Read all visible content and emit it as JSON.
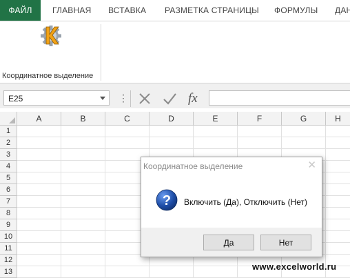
{
  "ribbon": {
    "tabs": [
      {
        "label": "ФАЙЛ"
      },
      {
        "label": "ГЛАВНАЯ"
      },
      {
        "label": "ВСТАВКА"
      },
      {
        "label": "РАЗМЕТКА СТРАНИЦЫ"
      },
      {
        "label": "ФОРМУЛЫ"
      },
      {
        "label": "ДАН"
      }
    ],
    "active_tab": "ФАЙЛ",
    "group_label": "Координатное выделение",
    "addin_icon": "addin-k-gear-icon"
  },
  "formula_bar": {
    "name_box": "E25",
    "cancel_icon": "cancel-x-icon",
    "enter_icon": "enter-check-icon",
    "function_icon": "fx-icon",
    "fx_label": "fx",
    "formula": ""
  },
  "sheet": {
    "columns": [
      "A",
      "B",
      "C",
      "D",
      "E",
      "F",
      "G",
      "H"
    ],
    "rows": [
      "1",
      "2",
      "3",
      "4",
      "5",
      "6",
      "7",
      "8",
      "9",
      "10",
      "11",
      "12",
      "13"
    ]
  },
  "dialog": {
    "title": "Координатное выделение",
    "icon": "question-icon",
    "message": "Включить (Да), Отключить (Нет)",
    "yes_label": "Да",
    "no_label": "Нет"
  },
  "watermark": "www.excelworld.ru",
  "colors": {
    "accent": "#217346",
    "question_icon": "#1e4ea8"
  }
}
